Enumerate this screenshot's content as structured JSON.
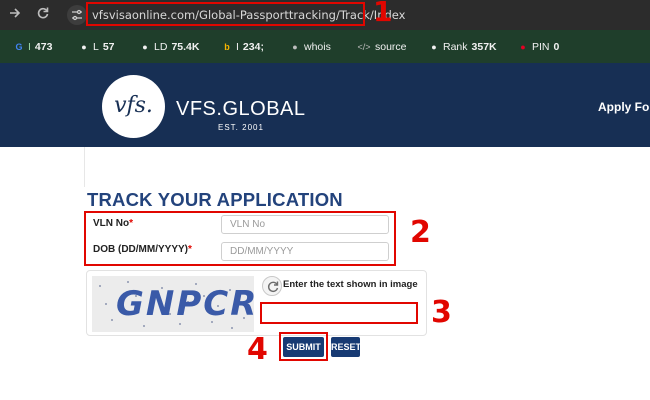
{
  "browser": {
    "url": "vfsvisaonline.com/Global-Passporttracking/Track/Index"
  },
  "annotations": [
    "1",
    "2",
    "3",
    "4"
  ],
  "extension_bar": {
    "items": [
      {
        "icon": "google-icon",
        "label": "I",
        "value": "473"
      },
      {
        "icon": "dot-icon",
        "label": "L",
        "value": "57"
      },
      {
        "icon": "dot-icon",
        "label": "LD",
        "value": "75.4K"
      },
      {
        "icon": "bing-icon",
        "label": "I",
        "value": "234;"
      },
      {
        "icon": "person-icon",
        "label": "whois",
        "value": ""
      },
      {
        "icon": "code-icon",
        "label": "source",
        "value": ""
      },
      {
        "icon": "dot-icon",
        "label": "Rank",
        "value": "357K"
      },
      {
        "icon": "pinterest-icon",
        "label": "PIN",
        "value": "0"
      }
    ]
  },
  "header": {
    "logo_mark": "vfs.",
    "brand": "VFS.GLOBAL",
    "est": "EST. 2001",
    "apply_link": "Apply For"
  },
  "form": {
    "title": "TRACK YOUR APPLICATION",
    "vln_label": "VLN No",
    "vln_placeholder": "VLN No",
    "dob_label": "DOB (DD/MM/YYYY)",
    "dob_placeholder": "DD/MM/YYYY",
    "required_mark": "*",
    "captcha_code": "GNPCR",
    "captcha_hint": "Enter the text shown in image",
    "submit_label": "SUBMIT",
    "reset_label": "RESET"
  },
  "colors": {
    "header_bg": "#172f54",
    "accent_red": "#e10600",
    "title_blue": "#23437c",
    "button_blue": "#173a73",
    "ext_bar_bg": "#1f3e2b"
  }
}
